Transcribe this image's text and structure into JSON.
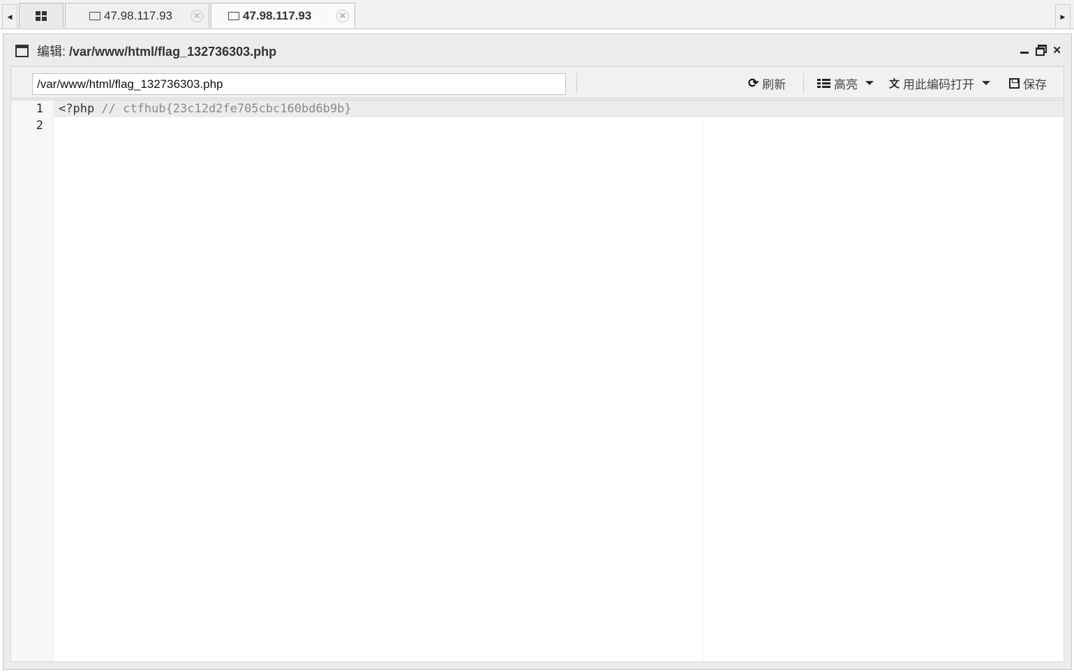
{
  "tabs": {
    "scroll_left": "◀",
    "scroll_right": "▶",
    "items": [
      {
        "label": "47.98.117.93",
        "close": "✕",
        "active": false
      },
      {
        "label": "47.98.117.93",
        "close": "✕",
        "active": true
      }
    ]
  },
  "window": {
    "title_prefix": "编辑:",
    "title_path": "/var/www/html/flag_132736303.php",
    "close": "✕"
  },
  "toolbar": {
    "path_value": "/var/www/html/flag_132736303.php",
    "refresh_icon": "⟳",
    "refresh_label": "刷新",
    "highlight_label": "高亮",
    "encoding_icon": "文",
    "encoding_label": "用此编码打开",
    "save_label": "保存"
  },
  "editor": {
    "lines": [
      {
        "num": "1",
        "tag": "<?php",
        "comment": " // ctfhub{23c12d2fe705cbc160bd6b9b}"
      },
      {
        "num": "2",
        "tag": "",
        "comment": ""
      }
    ]
  },
  "colors": {
    "comment": "#8a8a8a",
    "active_line": "#ececec",
    "gutter": "#f7f7f7"
  }
}
